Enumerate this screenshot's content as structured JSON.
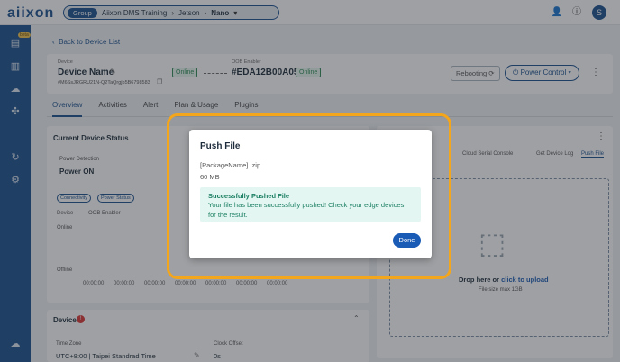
{
  "topbar": {
    "logo": "aiixon",
    "breadcrumb": {
      "group": "Group",
      "training": "Aiixon DMS Training",
      "jetson": "Jetson",
      "nano": "Nano"
    },
    "avatar": "S",
    "icons": [
      "add-user-icon",
      "info-icon"
    ]
  },
  "sidebar": {
    "beta_badge": "beta",
    "icons": [
      "dashboard-icon",
      "chart-icon",
      "cloud-icon",
      "puzzle-icon",
      "history-icon",
      "gear-icon",
      "cloud-off-icon"
    ]
  },
  "page": {
    "back_link": "Back to Device List",
    "device": {
      "label": "Device",
      "name": "Device Name",
      "id": "#M6SsJRGRU21N-Q2TaQrgjb5B6798583",
      "status": "Online",
      "oob_label": "OOB Enabler",
      "oob_id": "#EDA12B00A05",
      "oob_status": "Online",
      "rebooting": "Rebooting",
      "power_control": "Power Control"
    },
    "tabs": [
      {
        "label": "Overview"
      },
      {
        "label": "Activities"
      },
      {
        "label": "Alert"
      },
      {
        "label": "Plan & Usage"
      },
      {
        "label": "Plugins"
      }
    ],
    "status_panel": {
      "title": "Current Device Status",
      "power_label": "Power Detection",
      "power_value": "Power ON",
      "pills": [
        "Connectivity",
        "Power Status"
      ],
      "legend": [
        "Device",
        "OOB Enabler"
      ],
      "online": "Online",
      "offline": "Offline",
      "times": [
        "00:00:00",
        "00:00:00",
        "00:00:00",
        "00:00:00",
        "00:00:00",
        "00:00:00",
        "00:00:00"
      ]
    },
    "device_panel": {
      "title": "Device",
      "timezone_label": "Time Zone",
      "timezone_value": "UTC+8:00 | Taipei Standrad Time",
      "clock_label": "Clock Offset",
      "clock_value": "0s"
    },
    "right_tabs": {
      "cloud": "Cloud Serial Console",
      "get_log": "Get Device Log",
      "push": "Push File"
    },
    "dropzone": {
      "drop_text": "Drop here or",
      "link": "click to upload",
      "limit": "File size max 1GB"
    }
  },
  "modal": {
    "title": "Push File",
    "filename": "[PackageName]. zip",
    "size": "60 MB",
    "alert_title": "Successfully Pushed File",
    "alert_body": "Your file has been successfully pushed! Check your edge devices for the result.",
    "done": "Done"
  },
  "colors": {
    "brand": "#1a4f8f",
    "highlight": "#f3a51c",
    "success": "#1b7f63",
    "button": "#1a5bb5"
  }
}
